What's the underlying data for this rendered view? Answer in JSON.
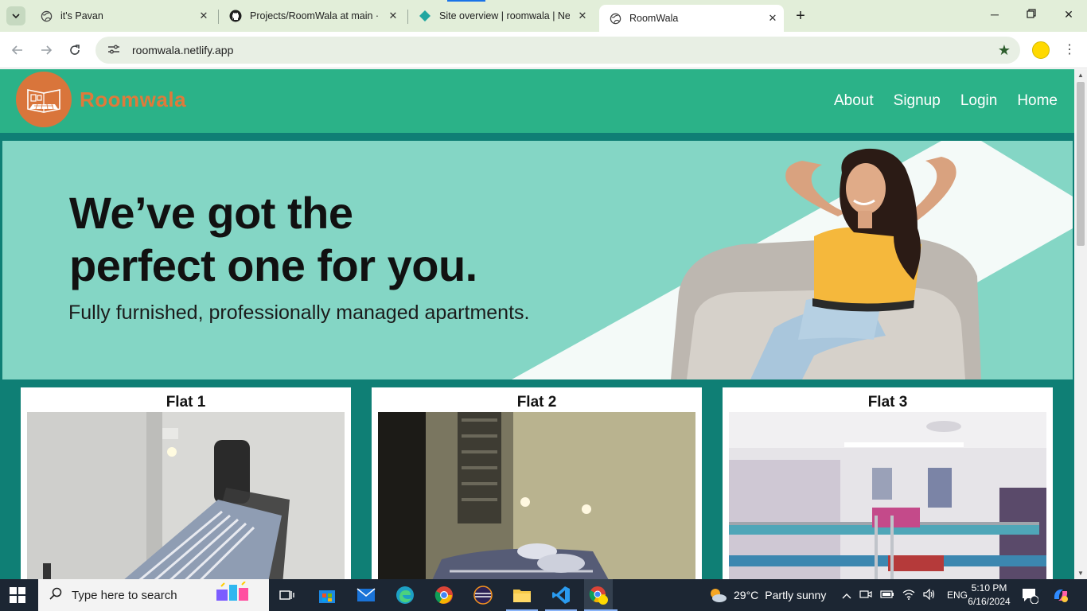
{
  "browser": {
    "tabs": [
      {
        "title": "it's Pavan",
        "active": false
      },
      {
        "title": "Projects/RoomWala at main · pa",
        "active": false
      },
      {
        "title": "Site overview | roomwala | Netlify",
        "active": false
      },
      {
        "title": "RoomWala",
        "active": true
      }
    ],
    "url": "roomwala.netlify.app"
  },
  "site": {
    "brand": "Roomwala",
    "nav": [
      "About",
      "Signup",
      "Login",
      "Home"
    ],
    "hero": {
      "line1": "We’ve got the",
      "line2": "perfect one for you.",
      "subtitle": "Fully furnished, professionally managed apartments."
    },
    "flats": [
      {
        "title": "Flat 1"
      },
      {
        "title": "Flat 2"
      },
      {
        "title": "Flat 3"
      }
    ],
    "colors": {
      "header": "#2bb288",
      "band": "#0f7f75",
      "brand": "#e07a3a",
      "hero_bg": "#7ed4c3"
    }
  },
  "taskbar": {
    "search_placeholder": "Type here to search",
    "weather": {
      "temp": "29°C",
      "condition": "Partly sunny"
    },
    "language": "ENG",
    "time": "5:10 PM",
    "date": "6/16/2024",
    "notification_count": "1"
  }
}
